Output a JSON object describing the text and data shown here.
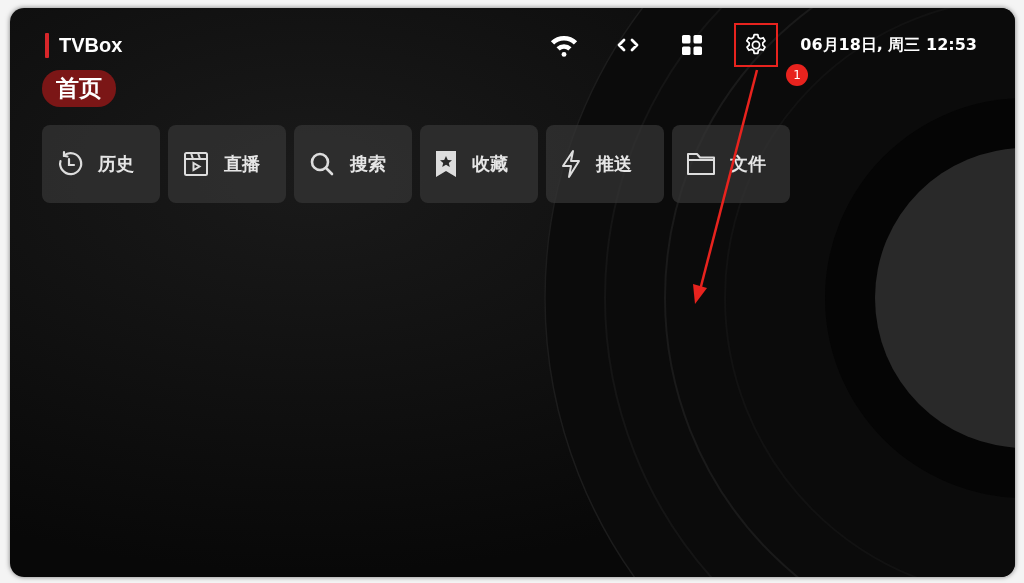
{
  "app": {
    "title": "TVBox"
  },
  "toolbar": [
    {
      "kind": "wifi",
      "highlighted": false
    },
    {
      "kind": "code",
      "highlighted": false
    },
    {
      "kind": "apps",
      "highlighted": false
    },
    {
      "kind": "settings",
      "highlighted": true
    }
  ],
  "datetime": "06月18日, 周三 12:53",
  "tabs": [
    {
      "label": "首页",
      "selected": true
    }
  ],
  "tiles": [
    {
      "kind": "history",
      "label": "历史"
    },
    {
      "kind": "live",
      "label": "直播"
    },
    {
      "kind": "search",
      "label": "搜索"
    },
    {
      "kind": "favorites",
      "label": "收藏"
    },
    {
      "kind": "push",
      "label": "推送"
    },
    {
      "kind": "files",
      "label": "文件"
    }
  ],
  "annotation": {
    "badge": "1"
  }
}
